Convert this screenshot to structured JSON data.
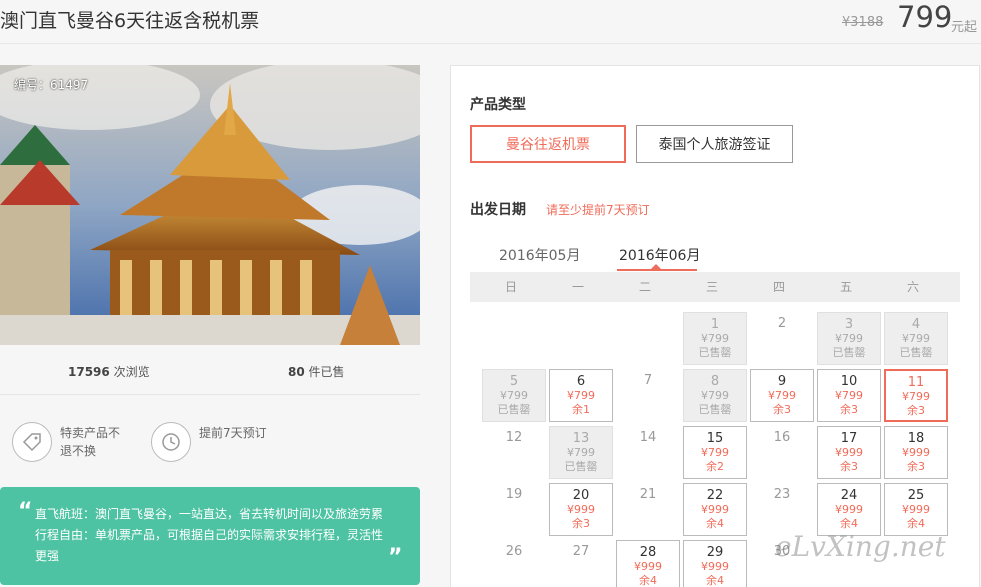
{
  "header": {
    "title": "澳门直飞曼谷6天往返含税机票",
    "original_price": "¥3188",
    "price": "799",
    "price_suffix": "元起"
  },
  "photo": {
    "code": "编号：61497"
  },
  "stats": {
    "views_count": "17596",
    "views_label": "次浏览",
    "sold_count": "80",
    "sold_label": "件已售"
  },
  "features": [
    {
      "text": "特卖产品不退不换",
      "icon": "tag-icon"
    },
    {
      "text": "提前7天预订",
      "icon": "clock-history-icon"
    }
  ],
  "quote": {
    "open": "“",
    "close": "”",
    "lines": [
      "直飞航班：澳门直飞曼谷，一站直达，省去转机时间以及旅途劳累",
      "行程自由：单机票产品，可根据自己的实际需求安排行程，灵活性更强"
    ]
  },
  "booking": {
    "type_label": "产品类型",
    "types": [
      "曼谷往返机票",
      "泰国个人旅游签证"
    ],
    "active_type": "曼谷往返机票",
    "date_label": "出发日期",
    "date_hint": "请至少提前7天预订",
    "months": [
      "2016年05月",
      "2016年06月"
    ],
    "active_month": "2016年06月",
    "weekdays": [
      "日",
      "一",
      "二",
      "三",
      "四",
      "五",
      "六"
    ]
  },
  "calendar": [
    {
      "day": "1",
      "col": 3,
      "row": 0,
      "status": "sold",
      "price": "¥799",
      "note": "已售罄"
    },
    {
      "day": "2",
      "col": 4,
      "row": 0,
      "status": "plain",
      "price": "",
      "note": ""
    },
    {
      "day": "3",
      "col": 5,
      "row": 0,
      "status": "sold",
      "price": "¥799",
      "note": "已售罄"
    },
    {
      "day": "4",
      "col": 6,
      "row": 0,
      "status": "sold",
      "price": "¥799",
      "note": "已售罄"
    },
    {
      "day": "5",
      "col": 0,
      "row": 1,
      "status": "sold",
      "price": "¥799",
      "note": "已售罄"
    },
    {
      "day": "6",
      "col": 1,
      "row": 1,
      "status": "avail",
      "price": "¥799",
      "note": "余1"
    },
    {
      "day": "7",
      "col": 2,
      "row": 1,
      "status": "plain",
      "price": "",
      "note": ""
    },
    {
      "day": "8",
      "col": 3,
      "row": 1,
      "status": "sold",
      "price": "¥799",
      "note": "已售罄"
    },
    {
      "day": "9",
      "col": 4,
      "row": 1,
      "status": "avail",
      "price": "¥799",
      "note": "余3"
    },
    {
      "day": "10",
      "col": 5,
      "row": 1,
      "status": "avail",
      "price": "¥799",
      "note": "余3"
    },
    {
      "day": "11",
      "col": 6,
      "row": 1,
      "status": "sel",
      "price": "¥799",
      "note": "余3"
    },
    {
      "day": "12",
      "col": 0,
      "row": 2,
      "status": "plain",
      "price": "",
      "note": ""
    },
    {
      "day": "13",
      "col": 1,
      "row": 2,
      "status": "sold",
      "price": "¥799",
      "note": "已售罄"
    },
    {
      "day": "14",
      "col": 2,
      "row": 2,
      "status": "plain",
      "price": "",
      "note": ""
    },
    {
      "day": "15",
      "col": 3,
      "row": 2,
      "status": "avail",
      "price": "¥799",
      "note": "余2"
    },
    {
      "day": "16",
      "col": 4,
      "row": 2,
      "status": "plain",
      "price": "",
      "note": ""
    },
    {
      "day": "17",
      "col": 5,
      "row": 2,
      "status": "avail",
      "price": "¥999",
      "note": "余3"
    },
    {
      "day": "18",
      "col": 6,
      "row": 2,
      "status": "avail",
      "price": "¥999",
      "note": "余3"
    },
    {
      "day": "19",
      "col": 0,
      "row": 3,
      "status": "plain",
      "price": "",
      "note": ""
    },
    {
      "day": "20",
      "col": 1,
      "row": 3,
      "status": "avail",
      "price": "¥999",
      "note": "余3"
    },
    {
      "day": "21",
      "col": 2,
      "row": 3,
      "status": "plain",
      "price": "",
      "note": ""
    },
    {
      "day": "22",
      "col": 3,
      "row": 3,
      "status": "avail",
      "price": "¥999",
      "note": "余4"
    },
    {
      "day": "23",
      "col": 4,
      "row": 3,
      "status": "plain",
      "price": "",
      "note": ""
    },
    {
      "day": "24",
      "col": 5,
      "row": 3,
      "status": "avail",
      "price": "¥999",
      "note": "余4"
    },
    {
      "day": "25",
      "col": 6,
      "row": 3,
      "status": "avail",
      "price": "¥999",
      "note": "余4"
    },
    {
      "day": "26",
      "col": 0,
      "row": 4,
      "status": "plain",
      "price": "",
      "note": ""
    },
    {
      "day": "27",
      "col": 1,
      "row": 4,
      "status": "plain",
      "price": "",
      "note": ""
    },
    {
      "day": "28",
      "col": 2,
      "row": 4,
      "status": "avail",
      "price": "¥999",
      "note": "余4"
    },
    {
      "day": "29",
      "col": 3,
      "row": 4,
      "status": "avail",
      "price": "¥999",
      "note": "余4"
    },
    {
      "day": "30",
      "col": 4,
      "row": 4,
      "status": "plain",
      "price": "",
      "note": ""
    }
  ],
  "watermark": "eLvXing.net"
}
